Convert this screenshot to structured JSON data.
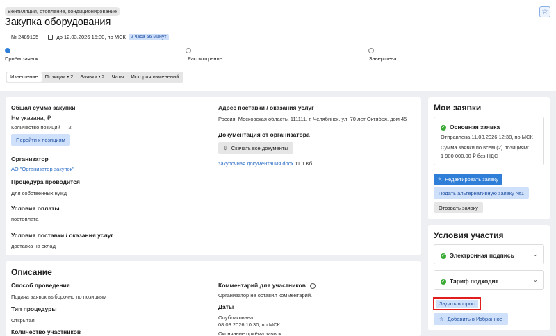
{
  "header": {
    "category": "Вентиляция, отопление, кондиционирование",
    "title": "Закупка оборудования",
    "number": "№ 2489195",
    "deadline": "до 12.03.2026 15:30, по МСК",
    "timer": "2 часа 56 минут"
  },
  "steps": [
    "Приём заявок",
    "Рассмотрение",
    "Завершена"
  ],
  "tabs": [
    "Извещение",
    "Позиции • 2",
    "Заявки • 2",
    "Чаты",
    "История изменений"
  ],
  "summary": {
    "total_title": "Общая сумма закупки",
    "total_value": "Не указана, ₽",
    "positions_count": "Количество позиций — 2",
    "goto_positions": "Перейти к позициям",
    "organizer_title": "Организатор",
    "organizer_value": "АО \"Организатор закупок\"",
    "procedure_title": "Процедура проводится",
    "procedure_value": "Для собственных нужд",
    "payment_title": "Условия оплаты",
    "payment_value": "постоплата",
    "delivery_title": "Условия поставки / оказания услуг",
    "delivery_value": "доставка на склад",
    "address_title": "Адрес поставки / оказания услуг",
    "address_value": "Россия, Московская область, 111111, г. Челябинск, ул. 70 лет Октября, дом 45",
    "docs_title": "Документация от организатора",
    "download_all": "Скачать все документы",
    "doc_file": "закупочная документация.docx",
    "doc_size": "11.1 Кб"
  },
  "description": {
    "title": "Описание",
    "method_title": "Способ проведения",
    "method_value": "Подача заявок выборочно по позициям",
    "type_title": "Тип процедуры",
    "type_value": "Открытая",
    "participants_title": "Количество участников",
    "comment_title": "Комментарий для участников",
    "comment_value": "Организатор не оставил комментарий.",
    "dates_title": "Даты",
    "published_label": "Опубликована",
    "published_value": "08.03.2026 10:30, по МСК",
    "end_label": "Окончание приёма заявок"
  },
  "my_bids": {
    "title": "Мои заявки",
    "main_bid": "Основная заявка",
    "sent": "Отправлена 11.03.2026 12:38, по МСК",
    "sum_label": "Сумма заявки по всем (2) позициям:",
    "sum_value": "1 900 000,00 ₽  без НДС",
    "edit": "Редактировать заявку",
    "alt": "Подать альтернативную заявку №1",
    "withdraw": "Отозвать заявку"
  },
  "conditions": {
    "title": "Условия участия",
    "signature": "Электронная подпись",
    "tariff": "Тариф подходит",
    "ask": "Задать вопрос",
    "favorite": "Добавить в Избранное"
  }
}
